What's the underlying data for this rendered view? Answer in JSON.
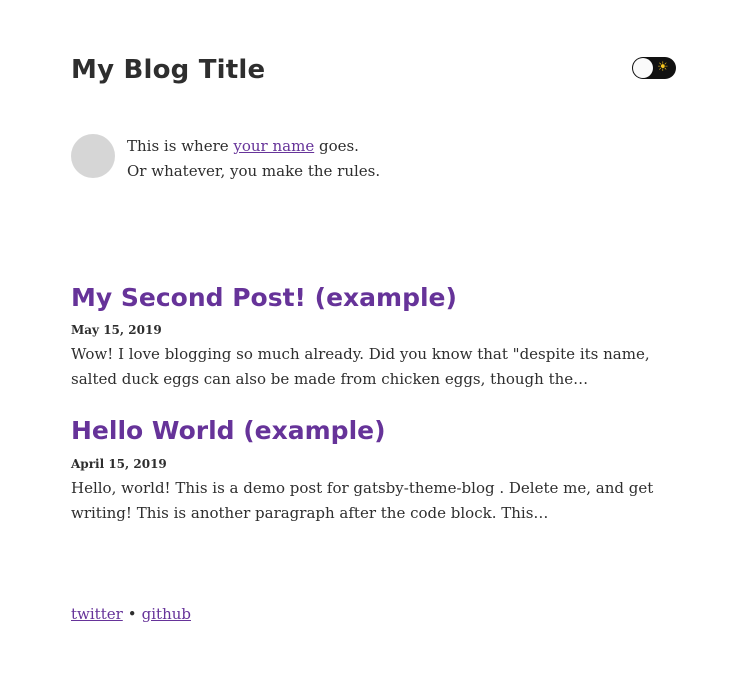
{
  "header": {
    "site_title": "My Blog Title",
    "theme_toggle_icon": "☀"
  },
  "bio": {
    "line1_prefix": "This is where ",
    "line1_link": "your name",
    "line1_suffix": " goes.",
    "line2": "Or whatever, you make the rules."
  },
  "posts": [
    {
      "title": "My Second Post! (example)",
      "date": "May 15, 2019",
      "excerpt": "Wow! I love blogging so much already. Did you know that \"despite its name, salted duck eggs can also be made from chicken eggs, though the…"
    },
    {
      "title": "Hello World (example)",
      "date": "April 15, 2019",
      "excerpt": "Hello, world! This is a demo post for gatsby-theme-blog . Delete me, and get writing! This is another paragraph after the code block. This…"
    }
  ],
  "footer": {
    "link1": "twitter",
    "separator": "•",
    "link2": "github"
  },
  "colors": {
    "accent": "#663399",
    "text": "#2e2e2e",
    "toggle_bg": "#111111",
    "sun": "#f7c61f"
  }
}
